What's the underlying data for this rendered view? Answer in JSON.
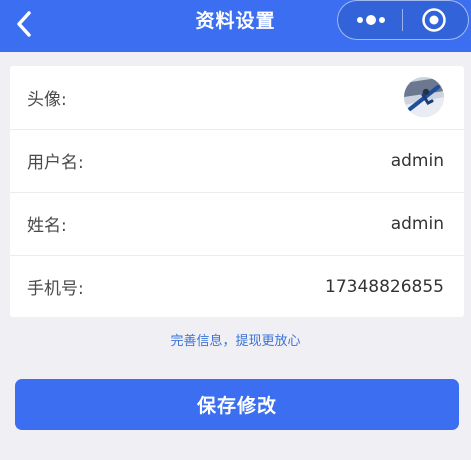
{
  "header": {
    "title": "资料设置",
    "back_icon": "chevron-left-icon",
    "more_icon": "more-dots-icon",
    "close_icon": "target-circle-icon",
    "background_color": "#3b6ef0"
  },
  "profile": {
    "rows": [
      {
        "label": "头像:",
        "type": "avatar",
        "value": ""
      },
      {
        "label": "用户名:",
        "type": "text",
        "value": "admin"
      },
      {
        "label": "姓名:",
        "type": "text",
        "value": "admin"
      },
      {
        "label": "手机号:",
        "type": "text",
        "value": "17348826855"
      }
    ]
  },
  "hint": {
    "text": "完善信息，提现更放心",
    "color": "#3a73d6"
  },
  "actions": {
    "save_label": "保存修改",
    "save_color": "#3b6ef0"
  }
}
